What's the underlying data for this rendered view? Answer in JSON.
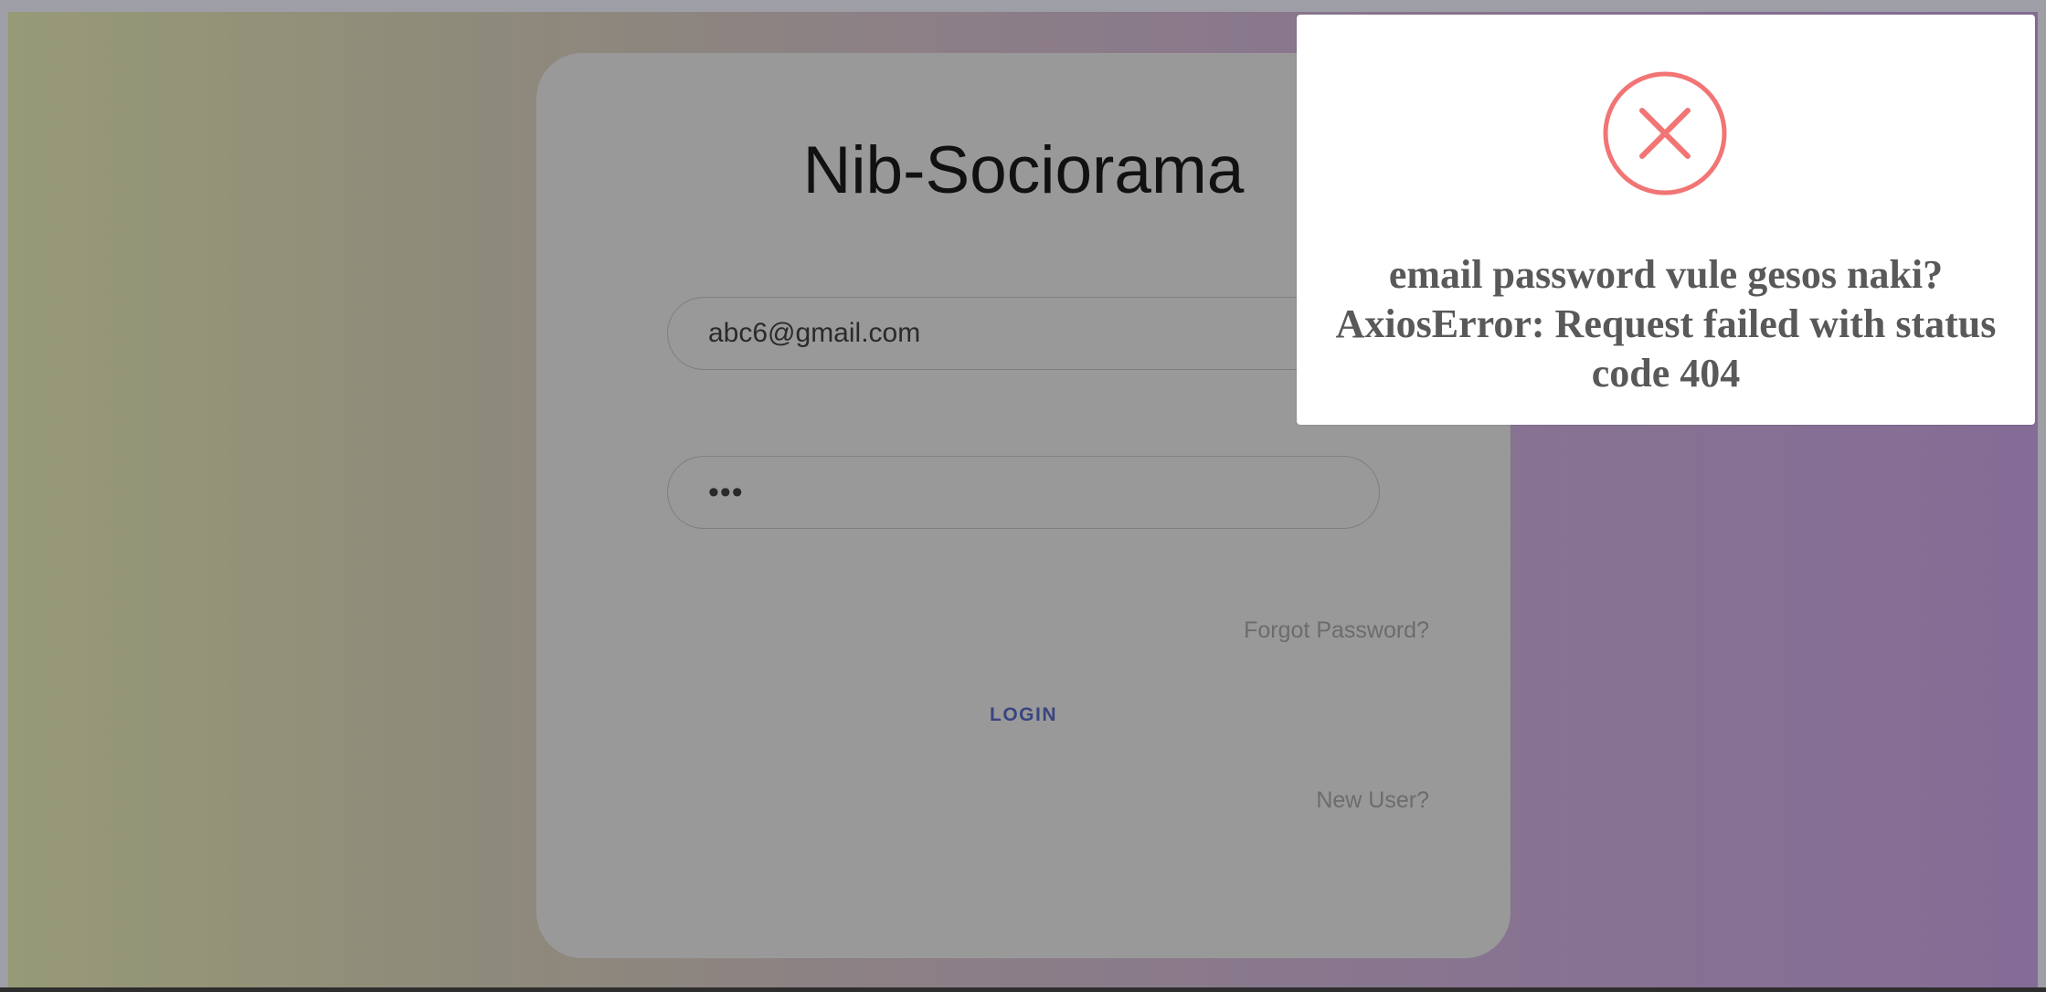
{
  "app": {
    "title": "Nib-Sociorama"
  },
  "login_form": {
    "email_value": "abc6@gmail.com",
    "password_value": "abc",
    "forgot_password_label": "Forgot Password?",
    "login_button_label": "LOGIN",
    "new_user_label": "New User?"
  },
  "alert": {
    "icon": "error-x-circle-icon",
    "message": "email password vule gesos naki? AxiosError: Request failed with status code 404"
  },
  "colors": {
    "error_icon": "#f27474",
    "login_button": "#3a4580",
    "alert_text": "#595959"
  }
}
